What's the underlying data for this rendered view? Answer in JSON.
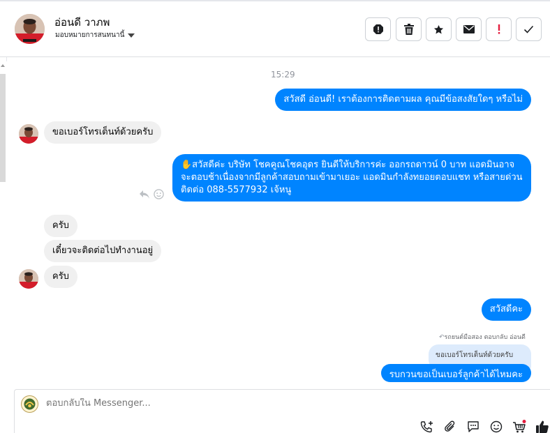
{
  "header": {
    "contact_name": "อ่อนดี วาภพ",
    "assign_label": "มอบหมายการสนทนานี้",
    "actions": [
      "warning-icon",
      "trash-icon",
      "star-icon",
      "mail-icon",
      "exclamation-icon",
      "check-icon"
    ]
  },
  "conversation": {
    "time_label": "15:29",
    "messages": [
      {
        "direction": "out",
        "text": "สวัสดี อ่อนดี! เราต้องการติดตามผล คุณมีข้อสงสัยใดๆ หรือไม่"
      },
      {
        "direction": "in",
        "text": "ขอเบอร์โทรเต็นท์ด้วยครับ"
      },
      {
        "direction": "out",
        "text": "✋สวัสดีค่ะ บริษัท โชคคูณโชคอุดร ยินดีให้บริการค่ะ ออกรถดาวน์ 0 บาท แอดมินอาจจะตอบช้าเนื่องจากมีลูกค้าสอบถามเข้ามาเยอะ แอดมินกำลังทยอยตอบแชท หรือสายด่วนติดต่อ 088-5577932 เจ้หนู"
      },
      {
        "direction": "in",
        "text": "ครับ"
      },
      {
        "direction": "in",
        "text": "เดี๋ยวจะติดต่อไปทำงานอยู่"
      },
      {
        "direction": "in",
        "text": "ครับ"
      },
      {
        "direction": "out",
        "text": "สวัสดีคะ"
      },
      {
        "direction": "out",
        "text": "รบกวนขอเป็นเบอร์ลูกค้าได้ไหมคะ"
      }
    ],
    "reply_note": "รถยนต์มือสอง ตอบกลับ อ่อนดี",
    "quoted_text": "ขอเบอร์โทรเต็นท์ด้วยครับ"
  },
  "composer": {
    "placeholder": "ตอบกลับใน Messenger...",
    "tools": [
      "phone-plus-icon",
      "paperclip-icon",
      "quick-reply-icon",
      "emoji-icon",
      "shop-cart-icon",
      "thumbs-up-icon"
    ]
  },
  "colors": {
    "outgoing_bubble": "#0084ff",
    "incoming_bubble": "#f0f0f0",
    "quoted_bubble": "#ddebfc",
    "alert_red": "#e41e3f"
  }
}
